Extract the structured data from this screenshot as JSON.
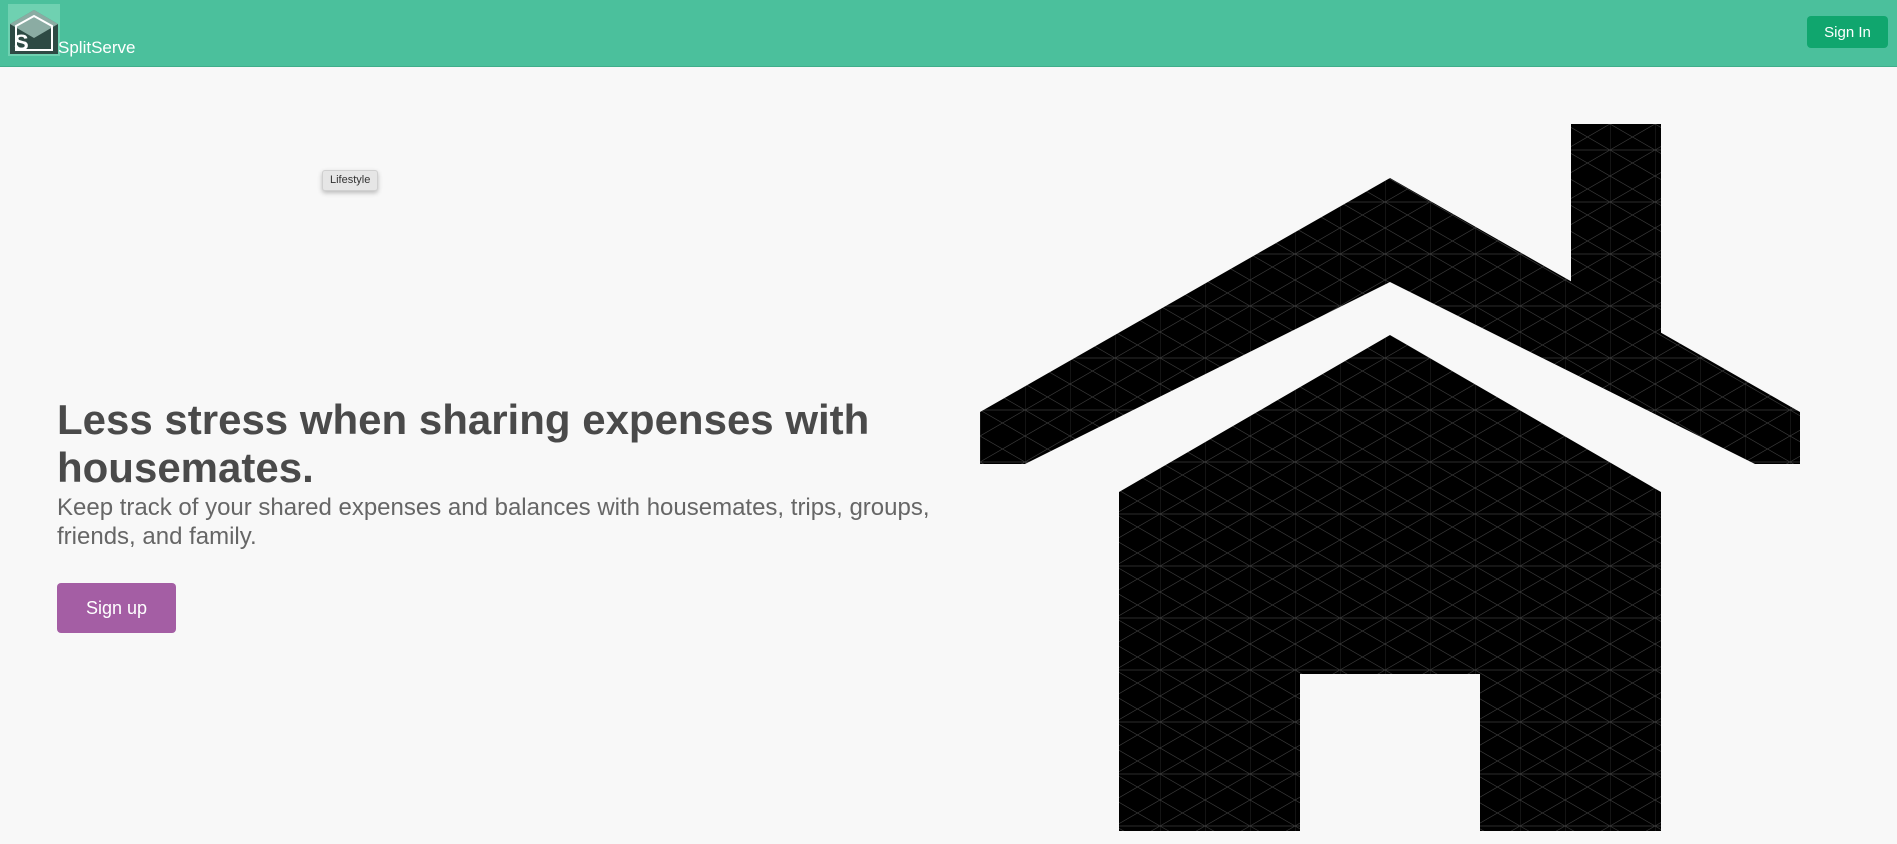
{
  "header": {
    "brand": "SplitServe",
    "sign_in_label": "Sign In",
    "background_color": "#4bc09c",
    "sign_in_color": "#10a66e"
  },
  "tag": {
    "label": "Lifestyle"
  },
  "hero": {
    "headline": "Less stress when sharing expenses with housemates.",
    "subtitle": "Keep track of your shared expenses and balances with housemates, trips, groups, friends, and family.",
    "sign_up_label": "Sign up",
    "sign_up_color": "#a45ea4"
  },
  "illustration": {
    "icon": "house-icon",
    "fill": "#000000"
  }
}
